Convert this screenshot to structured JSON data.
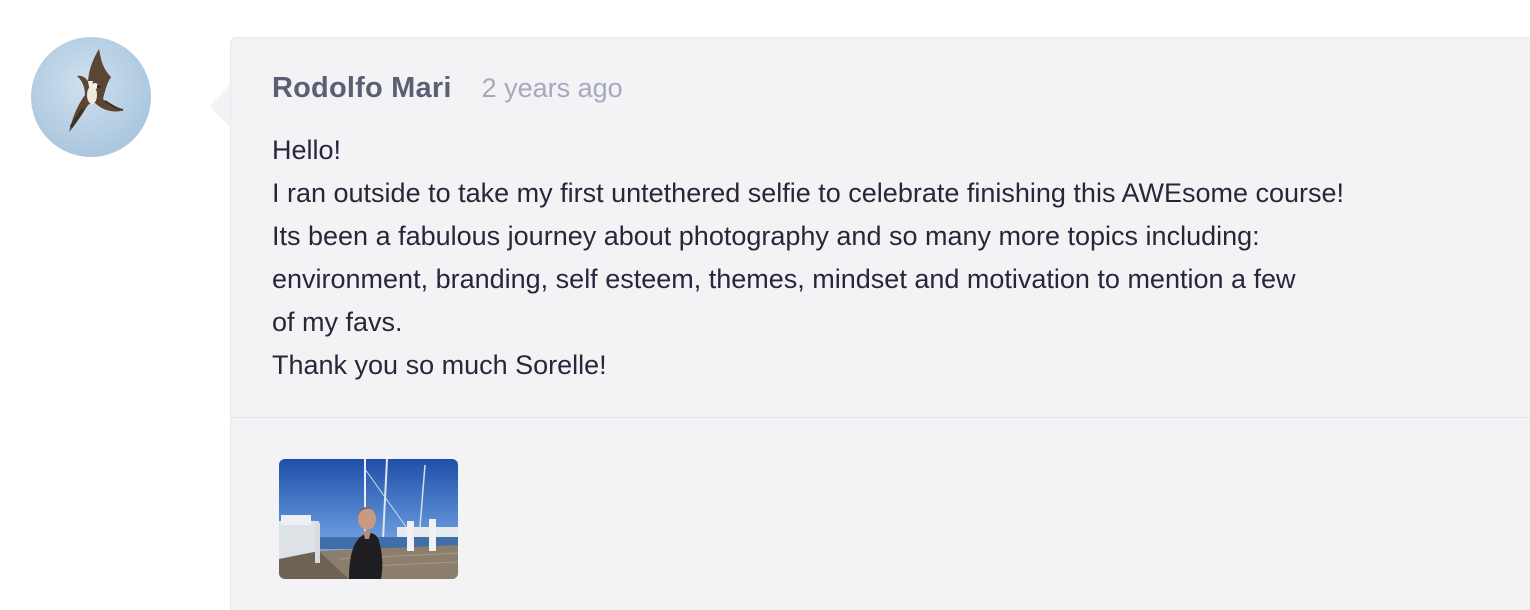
{
  "comment": {
    "author": "Rodolfo Mari",
    "timestamp": "2 years ago",
    "body_lines": [
      "Hello!",
      "I ran outside to take my first untethered selfie to celebrate finishing this AWEsome course!",
      "Its been a fabulous journey about photography and so many more topics including:",
      "environment, branding, self esteem, themes, mindset and motivation to mention a few",
      "of my favs.",
      "Thank you so much Sorelle!"
    ],
    "avatar_icon": "osprey-photo",
    "attachment_icon": "selfie-photo-thumbnail"
  },
  "colors": {
    "bubble_background": "#f3f3f6",
    "author": "#5b5f74",
    "timestamp": "#a5a9bb",
    "body_text": "#26283a"
  }
}
